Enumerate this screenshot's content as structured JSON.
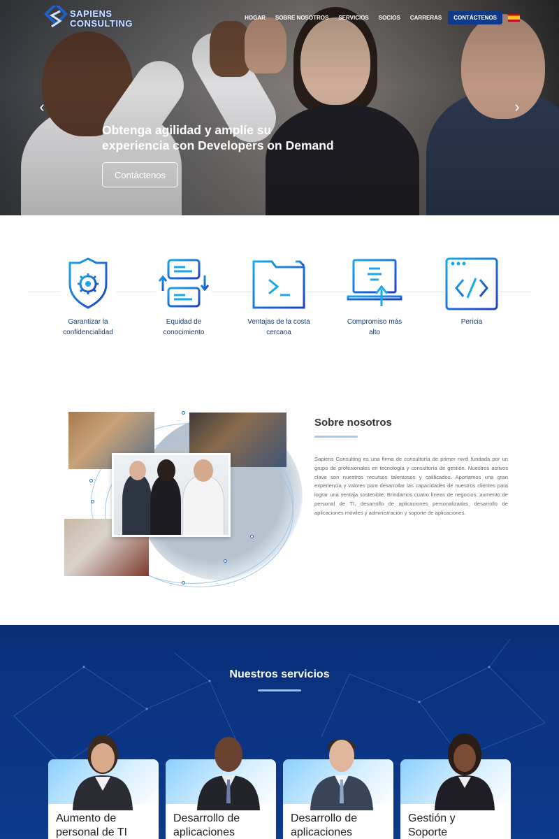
{
  "brand": {
    "line1": "SAPIENS",
    "line2": "CONSULTING"
  },
  "nav": {
    "items": [
      "HOGAR",
      "SOBRE NOSOTROS",
      "SERVICIOS",
      "SOCIOS",
      "CARRERAS"
    ],
    "cta": "CONTÁCTENOS",
    "language_flag": "spain-flag-icon"
  },
  "hero": {
    "headline": "Obtenga agilidad y amplíe su experiencia con Developers on Demand",
    "button": "Contáctenos",
    "prev_icon": "chevron-left-icon",
    "next_icon": "chevron-right-icon"
  },
  "features": [
    {
      "line1": "Garantizar la",
      "line2": "confidencialidad",
      "icon": "shield-gear-icon"
    },
    {
      "line1": "Equidad de",
      "line2": "conocimiento",
      "icon": "exchange-cards-icon"
    },
    {
      "line1": "Ventajas de la costa",
      "line2": "cercana",
      "icon": "folder-terminal-icon"
    },
    {
      "line1": "Compromiso más",
      "line2": "alto",
      "icon": "laptop-upload-icon"
    },
    {
      "line1": "Pericia",
      "line2": "",
      "icon": "code-window-icon"
    }
  ],
  "about": {
    "title": "Sobre nosotros",
    "text": "Sapiens Consulting es una firma de consultoría de primer nivel fundada por un grupo de profesionales en tecnología y consultoría de gestión. Nuestros activos clave son nuestros recursos talentosos y calificados. Aportamos una gran experiencia y valores para desarrollar las capacidades de nuestros clientes para lograr una ventaja sostenible. Brindamos cuatro líneas de negocios: aumento de personal de TI, desarrollo de aplicaciones personalizadas, desarrollo de aplicaciones móviles y administración y soporte de aplicaciones."
  },
  "services": {
    "title": "Nuestros servicios",
    "cards": [
      {
        "line1": "Aumento de",
        "line2": "personal de TI"
      },
      {
        "line1": "Desarrollo de",
        "line2": "aplicaciones"
      },
      {
        "line1": "Desarrollo de",
        "line2": "aplicaciones"
      },
      {
        "line1": "Gestión y",
        "line2": "Soporte"
      }
    ]
  },
  "colors": {
    "primary": "#0f3a8a",
    "accent": "#1f6fd1",
    "services_bg": "#0a2f7a"
  }
}
